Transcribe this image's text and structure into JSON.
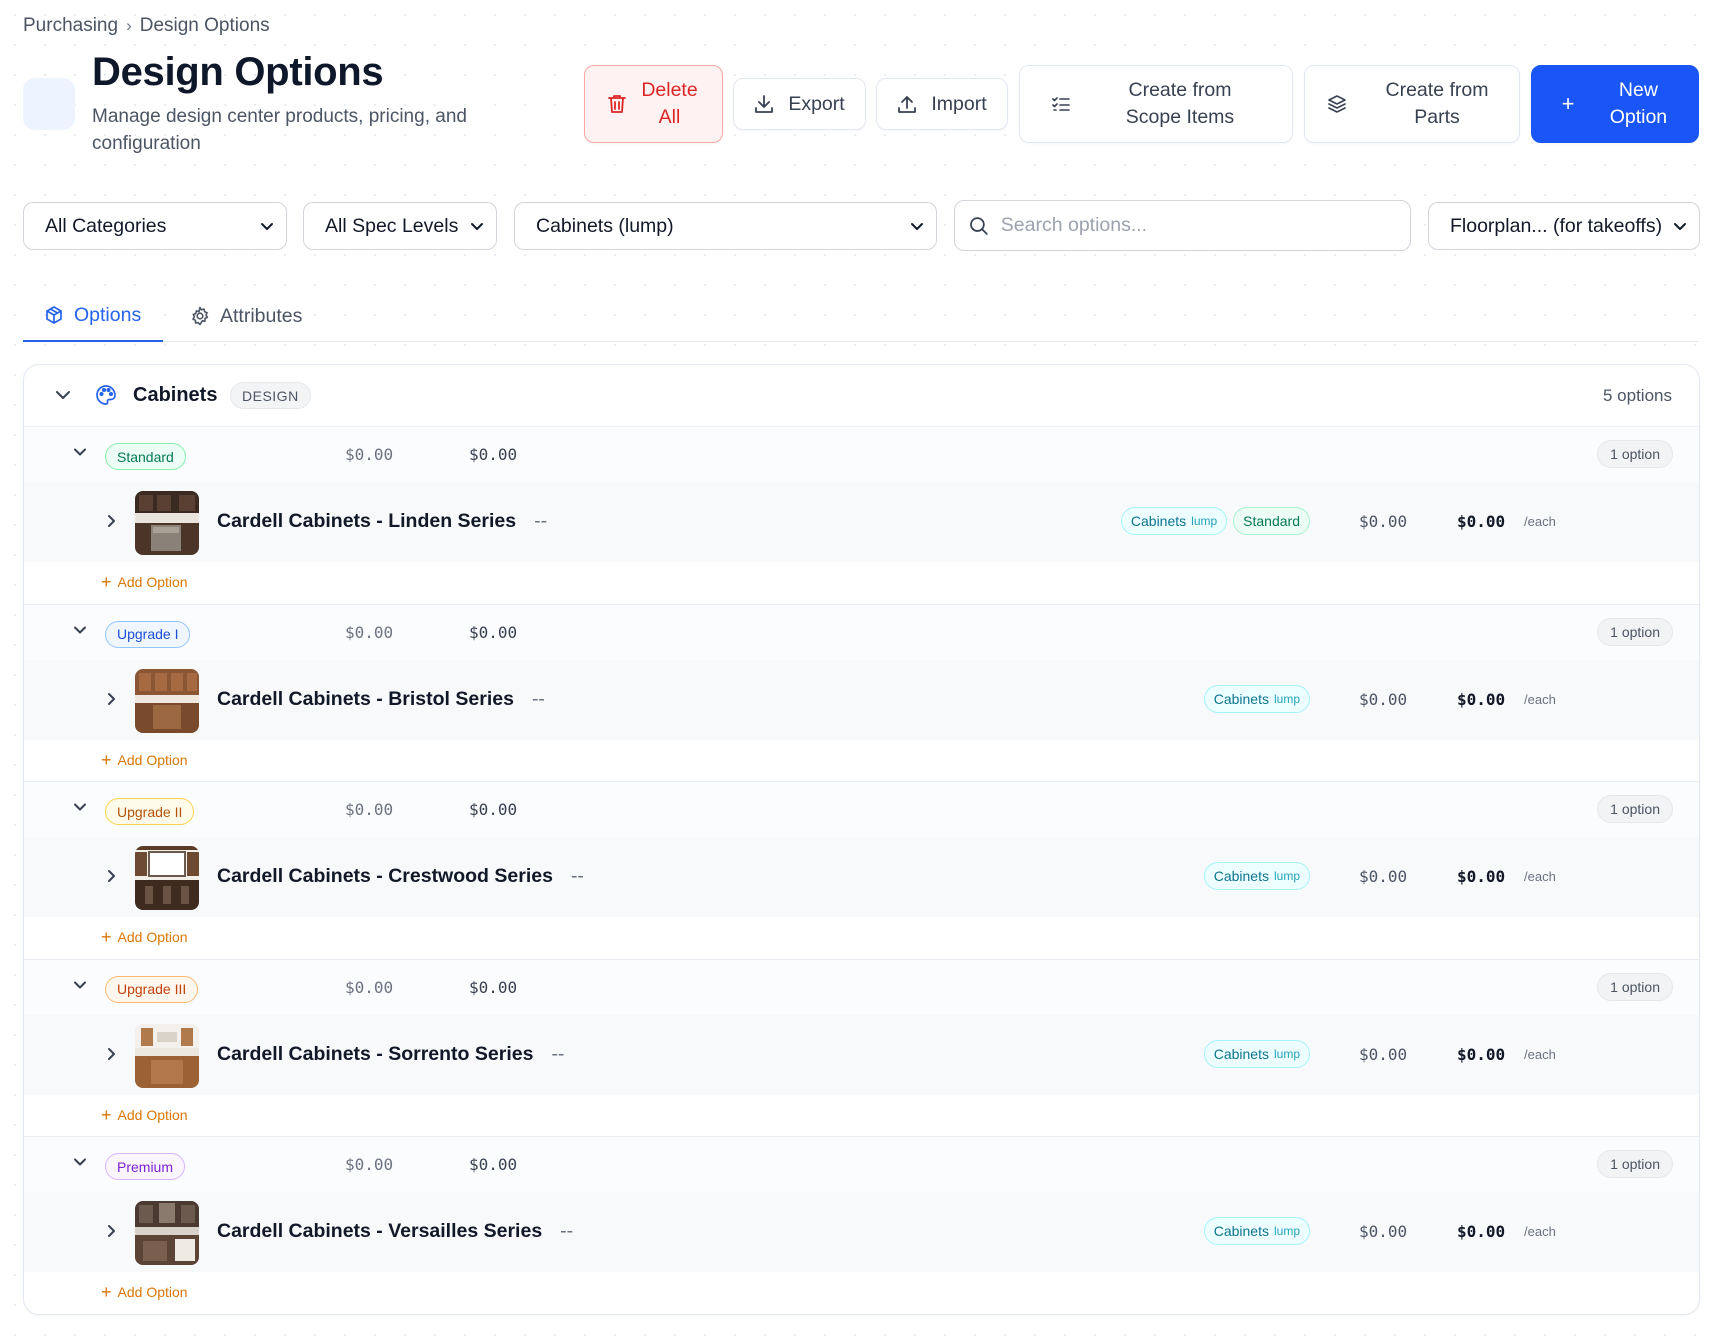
{
  "breadcrumb": {
    "parent": "Purchasing",
    "separator": "›",
    "current": "Design Options"
  },
  "header": {
    "title": "Design Options",
    "subtitle": "Manage design center products, pricing, and configuration"
  },
  "toolbar": {
    "delete_all": "Delete All",
    "export": "Export",
    "import": "Import",
    "create_from_scope": "Create from Scope Items",
    "create_from_parts": "Create from Parts",
    "new_option": "New Option"
  },
  "filters": {
    "categories": "All Categories",
    "spec_levels": "All Spec Levels",
    "part": "Cabinets (lump)",
    "search_placeholder": "Search options...",
    "floorplan": "Floorplan... (for takeoffs)"
  },
  "tabs": [
    {
      "label": "Options",
      "active": true
    },
    {
      "label": "Attributes",
      "active": false
    }
  ],
  "group": {
    "name": "Cabinets",
    "type_badge": "DESIGN",
    "count": "5 options",
    "levels": [
      {
        "spec": "Standard",
        "cost": "$0.00",
        "price": "$0.00",
        "count": "1 option",
        "option": {
          "name": "Cardell Cabinets - Linden Series",
          "dash": "--",
          "tag": "Cabinets",
          "tag_sub": "lump",
          "spec_tag": "Standard",
          "cost": "$0.00",
          "price": "$0.00",
          "unit": "/each"
        },
        "add_label": "Add Option"
      },
      {
        "spec": "Upgrade I",
        "cost": "$0.00",
        "price": "$0.00",
        "count": "1 option",
        "option": {
          "name": "Cardell Cabinets - Bristol Series",
          "dash": "--",
          "tag": "Cabinets",
          "tag_sub": "lump",
          "cost": "$0.00",
          "price": "$0.00",
          "unit": "/each"
        },
        "add_label": "Add Option"
      },
      {
        "spec": "Upgrade II",
        "cost": "$0.00",
        "price": "$0.00",
        "count": "1 option",
        "option": {
          "name": "Cardell Cabinets - Crestwood Series",
          "dash": "--",
          "tag": "Cabinets",
          "tag_sub": "lump",
          "cost": "$0.00",
          "price": "$0.00",
          "unit": "/each"
        },
        "add_label": "Add Option"
      },
      {
        "spec": "Upgrade III",
        "cost": "$0.00",
        "price": "$0.00",
        "count": "1 option",
        "option": {
          "name": "Cardell Cabinets - Sorrento Series",
          "dash": "--",
          "tag": "Cabinets",
          "tag_sub": "lump",
          "cost": "$0.00",
          "price": "$0.00",
          "unit": "/each"
        },
        "add_label": "Add Option"
      },
      {
        "spec": "Premium",
        "cost": "$0.00",
        "price": "$0.00",
        "count": "1 option",
        "option": {
          "name": "Cardell Cabinets - Versailles Series",
          "dash": "--",
          "tag": "Cabinets",
          "tag_sub": "lump",
          "cost": "$0.00",
          "price": "$0.00",
          "unit": "/each"
        },
        "add_label": "Add Option"
      }
    ]
  },
  "colors": {
    "accent": "#1a56f7",
    "danger": "#dc2626",
    "add_option": "#d97706",
    "spec_standard": "#047857",
    "spec_upgrade_1": "#1d4ed8",
    "spec_upgrade_2": "#b45309",
    "spec_upgrade_3": "#c2410c",
    "spec_premium": "#7e22ce"
  }
}
